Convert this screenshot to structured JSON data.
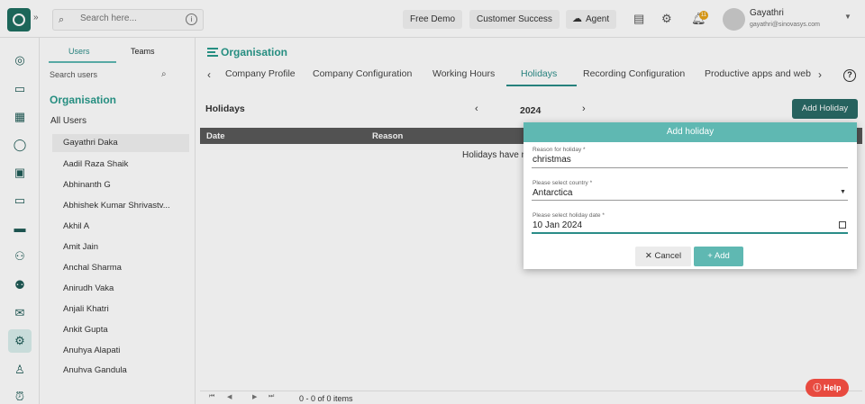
{
  "header": {
    "search_placeholder": "Search here...",
    "buttons": {
      "free_demo": "Free Demo",
      "customer_success": "Customer Success",
      "agent": "Agent"
    },
    "notification_count": "11",
    "user": {
      "name": "Gayathri",
      "email": "gayathri@sinovasys.com"
    }
  },
  "side_panel": {
    "tabs": [
      "Users",
      "Teams"
    ],
    "search_placeholder": "Search users",
    "section_title": "Organisation",
    "all_users_label": "All Users",
    "users": [
      "Gayathri Daka",
      "Aadil Raza Shaik",
      "Abhinanth G",
      "Abhishek Kumar Shrivastv...",
      "Akhil A",
      "Amit Jain",
      "Anchal Sharma",
      "Anirudh Vaka",
      "Anjali Khatri",
      "Ankit Gupta",
      "Anuhya Alapati",
      "Anuhya Gandula"
    ]
  },
  "main": {
    "title": "Organisation",
    "tabs": [
      "Company Profile",
      "Company Configuration",
      "Working Hours",
      "Holidays",
      "Recording Configuration",
      "Productive apps and web"
    ],
    "active_tab": "Holidays",
    "section_title": "Holidays",
    "year": "2024",
    "add_holiday_label": "Add Holiday",
    "table": {
      "columns": [
        "Date",
        "Reason"
      ],
      "empty_message": "Holidays have n"
    },
    "pagination": {
      "info": "0 - 0 of 0 items"
    }
  },
  "dialog": {
    "title": "Add holiday",
    "fields": {
      "reason": {
        "label": "Reason for holiday",
        "value": "christmas"
      },
      "country": {
        "label": "Please select country",
        "value": "Antarctica"
      },
      "date": {
        "label": "Please select holiday date",
        "value": "10 Jan 2024"
      }
    },
    "required_marker": "*",
    "cancel_label": "Cancel",
    "add_label": "Add"
  },
  "help_label": "Help"
}
